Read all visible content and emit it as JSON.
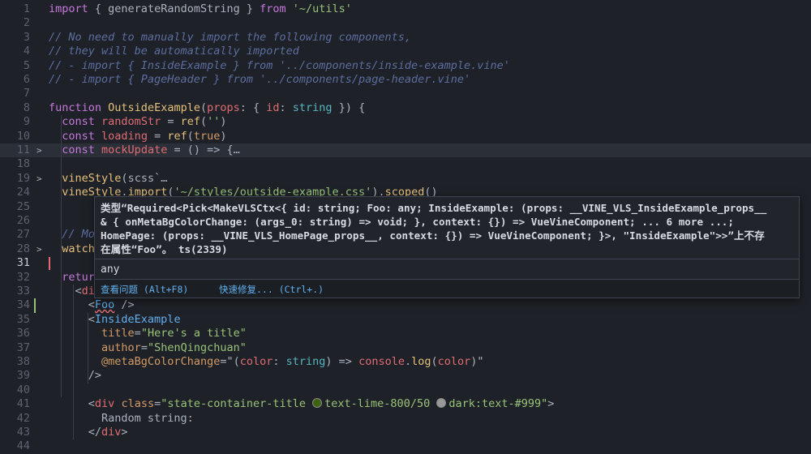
{
  "editor": {
    "lines": [
      {
        "n": "1",
        "parts": [
          [
            "kw",
            "import"
          ],
          [
            "p",
            " { "
          ],
          [
            "p",
            "generateRandomString"
          ],
          [
            "p",
            " } "
          ],
          [
            "kw",
            "from"
          ],
          [
            "p",
            " "
          ],
          [
            "s",
            "'~/utils'"
          ]
        ]
      },
      {
        "n": "2",
        "parts": []
      },
      {
        "n": "3",
        "parts": [
          [
            "c",
            "// No need to manually import the following components,"
          ]
        ]
      },
      {
        "n": "4",
        "parts": [
          [
            "c",
            "// they will be automatically imported"
          ]
        ]
      },
      {
        "n": "5",
        "parts": [
          [
            "c",
            "// - import { InsideExample } from '../components/inside-example.vine'"
          ]
        ]
      },
      {
        "n": "6",
        "parts": [
          [
            "c",
            "// - import { PageHeader } from '../components/page-header.vine'"
          ]
        ]
      },
      {
        "n": "7",
        "parts": []
      },
      {
        "n": "8",
        "parts": [
          [
            "kw",
            "function"
          ],
          [
            "p",
            " "
          ],
          [
            "f",
            "OutsideExample"
          ],
          [
            "p",
            "("
          ],
          [
            "v",
            "props"
          ],
          [
            "p",
            ": { "
          ],
          [
            "v",
            "id"
          ],
          [
            "p",
            ": "
          ],
          [
            "t",
            "string"
          ],
          [
            "p",
            " }) {"
          ]
        ]
      },
      {
        "n": "9",
        "parts": [
          [
            "p",
            "  "
          ],
          [
            "kw",
            "const"
          ],
          [
            "p",
            " "
          ],
          [
            "v",
            "randomStr"
          ],
          [
            "p",
            " = "
          ],
          [
            "f",
            "ref"
          ],
          [
            "p",
            "("
          ],
          [
            "s",
            "''"
          ],
          [
            "p",
            ")"
          ]
        ]
      },
      {
        "n": "10",
        "parts": [
          [
            "p",
            "  "
          ],
          [
            "kw",
            "const"
          ],
          [
            "p",
            " "
          ],
          [
            "v",
            "loading"
          ],
          [
            "p",
            " = "
          ],
          [
            "f",
            "ref"
          ],
          [
            "p",
            "("
          ],
          [
            "o",
            "true"
          ],
          [
            "p",
            ")"
          ]
        ]
      },
      {
        "n": "11",
        "fold": ">",
        "hl": true,
        "parts": [
          [
            "p",
            "  "
          ],
          [
            "kw",
            "const"
          ],
          [
            "p",
            " "
          ],
          [
            "v",
            "mockUpdate"
          ],
          [
            "p",
            " = () => {…"
          ]
        ]
      },
      {
        "n": "18",
        "parts": []
      },
      {
        "n": "19",
        "fold": ">",
        "parts": [
          [
            "p",
            "  "
          ],
          [
            "f",
            "vineStyle"
          ],
          [
            "p",
            "("
          ],
          [
            "p",
            "scss"
          ],
          [
            "p",
            "`…"
          ]
        ]
      },
      {
        "n": "24",
        "parts": [
          [
            "p",
            "  "
          ],
          [
            "f",
            "vineStyle"
          ],
          [
            "p",
            "."
          ],
          [
            "f",
            "import"
          ],
          [
            "p",
            "("
          ],
          [
            "s",
            "'~/styles/outside-example.css'"
          ],
          [
            "p",
            ")."
          ],
          [
            "f",
            "scoped"
          ],
          [
            "p",
            "()"
          ]
        ]
      },
      {
        "n": "25",
        "parts": []
      },
      {
        "n": "26",
        "parts": []
      },
      {
        "n": "27",
        "parts": [
          [
            "p",
            "  "
          ],
          [
            "c",
            "// Mo"
          ]
        ]
      },
      {
        "n": "28",
        "fold": ">",
        "parts": [
          [
            "p",
            "  "
          ],
          [
            "f",
            "watch"
          ]
        ]
      },
      {
        "n": "31",
        "cur": true,
        "parts": []
      },
      {
        "n": "32",
        "parts": [
          [
            "p",
            "  "
          ],
          [
            "kw",
            "retur"
          ]
        ]
      },
      {
        "n": "33",
        "parts": [
          [
            "p",
            "    <"
          ],
          [
            "v",
            "di"
          ]
        ]
      },
      {
        "n": "34",
        "parts": [
          [
            "p",
            "      <"
          ],
          [
            "tag",
            "Foo"
          ],
          [
            "p",
            " />"
          ]
        ]
      },
      {
        "n": "35",
        "parts": [
          [
            "p",
            "      <"
          ],
          [
            "tag",
            "InsideExample"
          ]
        ]
      },
      {
        "n": "36",
        "parts": [
          [
            "p",
            "        "
          ],
          [
            "attr",
            "title"
          ],
          [
            "p",
            "="
          ],
          [
            "s",
            "\"Here's a title\""
          ]
        ]
      },
      {
        "n": "37",
        "parts": [
          [
            "p",
            "        "
          ],
          [
            "attr",
            "author"
          ],
          [
            "p",
            "="
          ],
          [
            "s",
            "\"ShenQingchuan\""
          ]
        ]
      },
      {
        "n": "38",
        "parts": [
          [
            "p",
            "        "
          ],
          [
            "attr",
            "@metaBgColorChange"
          ],
          [
            "p",
            "=\"("
          ],
          [
            "v",
            "color"
          ],
          [
            "p",
            ": "
          ],
          [
            "t",
            "string"
          ],
          [
            "p",
            ") => "
          ],
          [
            "v",
            "console"
          ],
          [
            "p",
            "."
          ],
          [
            "f",
            "log"
          ],
          [
            "p",
            "("
          ],
          [
            "v",
            "color"
          ],
          [
            "p",
            ")\""
          ]
        ]
      },
      {
        "n": "39",
        "parts": [
          [
            "p",
            "      />"
          ]
        ]
      },
      {
        "n": "40",
        "parts": []
      },
      {
        "n": "41",
        "parts": [
          [
            "p",
            "      <"
          ],
          [
            "v",
            "div"
          ],
          [
            "p",
            " "
          ],
          [
            "attr",
            "class"
          ],
          [
            "p",
            "="
          ],
          [
            "s",
            "\"state-container-title "
          ],
          [
            "dot1",
            ""
          ],
          [
            "s",
            "text-lime-800/50 "
          ],
          [
            "dot2",
            ""
          ],
          [
            "s",
            "dark:text-#999\""
          ],
          [
            "p",
            ">"
          ]
        ]
      },
      {
        "n": "42",
        "parts": [
          [
            "p",
            "        Random string:"
          ]
        ]
      },
      {
        "n": "43",
        "parts": [
          [
            "p",
            "      </"
          ],
          [
            "v",
            "div"
          ],
          [
            "p",
            ">"
          ]
        ]
      },
      {
        "n": "44",
        "parts": []
      }
    ]
  },
  "hover": {
    "message_line1": "类型“Required<Pick<MakeVLSCtx<{ id: string; Foo: any; InsideExample: (props: __VINE_VLS_InsideExample_props__",
    "message_line2": "& { onMetaBgColorChange: (args_0: string) => void; }, context: {}) => VueVineComponent; ... 6 more ...;",
    "message_line3": "HomePage: (props: __VINE_VLS_HomePage_props__, context: {}) => VueVineComponent; }>, \"InsideExample\">>”上不存",
    "message_line4": "在属性“Foo”。 ts(2339)",
    "type_info": "any",
    "action_view_problem": "查看问题 (Alt+F8)",
    "action_quick_fix": "快速修复... (Ctrl+.)"
  },
  "colors": {
    "lime": "#3f6212",
    "gray": "#999999"
  }
}
